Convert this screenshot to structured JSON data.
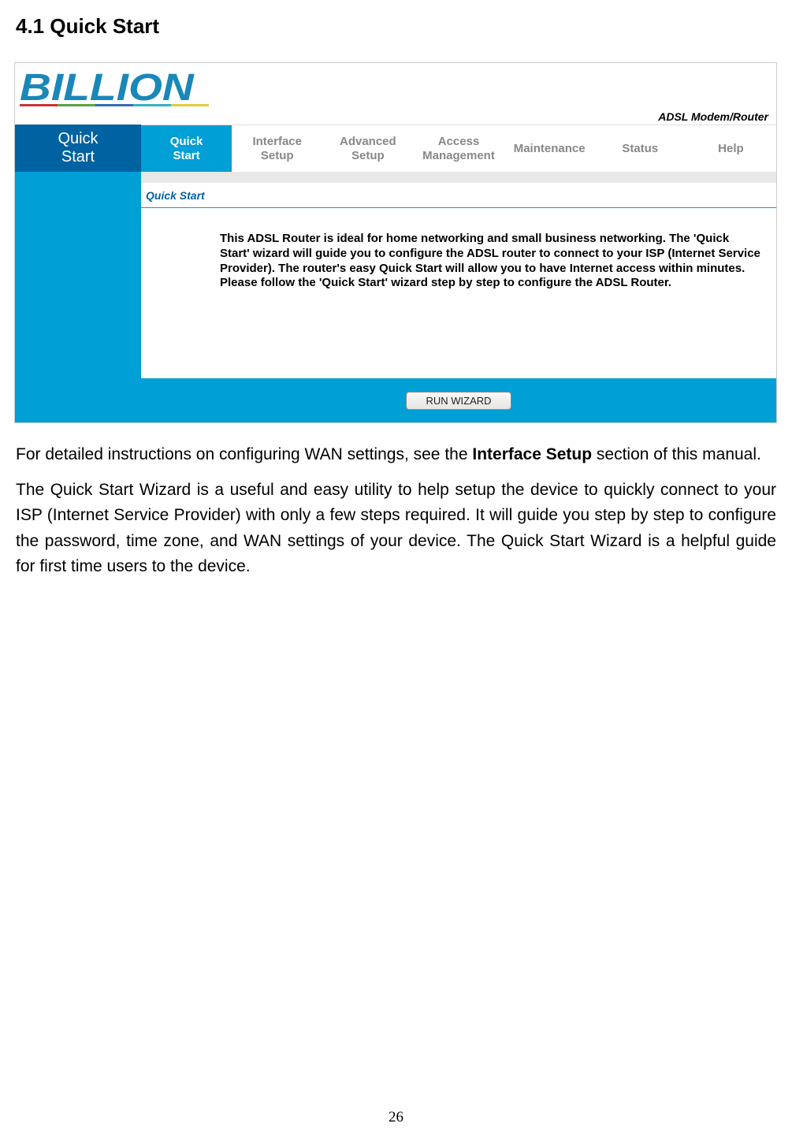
{
  "heading": "4.1 Quick Start",
  "logo_text": "BILLION",
  "device_label": "ADSL Modem/Router",
  "nav": {
    "section": "Quick\nStart",
    "tabs": [
      {
        "line1": "Quick",
        "line2": "Start",
        "active": true
      },
      {
        "line1": "Interface",
        "line2": "Setup",
        "active": false
      },
      {
        "line1": "Advanced",
        "line2": "Setup",
        "active": false
      },
      {
        "line1": "Access",
        "line2": "Management",
        "active": false
      },
      {
        "line1": "Maintenance",
        "line2": "",
        "active": false
      },
      {
        "line1": "Status",
        "line2": "",
        "active": false
      },
      {
        "line1": "Help",
        "line2": "",
        "active": false
      }
    ]
  },
  "sub_label": "Quick Start",
  "desc": "This ADSL Router is ideal for home networking and small business networking. The 'Quick Start' wizard will guide you to configure the ADSL router to connect to your ISP (Internet Service Provider). The router's easy Quick Start will allow you to have Internet access within minutes. Please follow the 'Quick Start' wizard step by step to configure the ADSL Router.",
  "wizard_button": "RUN WIZARD",
  "para1_a": "For detailed instructions on configuring WAN settings, see the ",
  "para1_b": "Interface Setup",
  "para1_c": " section of this manual.",
  "para2": "The Quick Start Wizard is a useful and easy utility to help setup the device to quickly connect to your ISP (Internet Service Provider) with only a few steps required. It will guide you step by step to configure the password, time zone, and WAN settings of your device. The Quick Start Wizard is a helpful guide for first time users to the device.",
  "page_number": "26"
}
